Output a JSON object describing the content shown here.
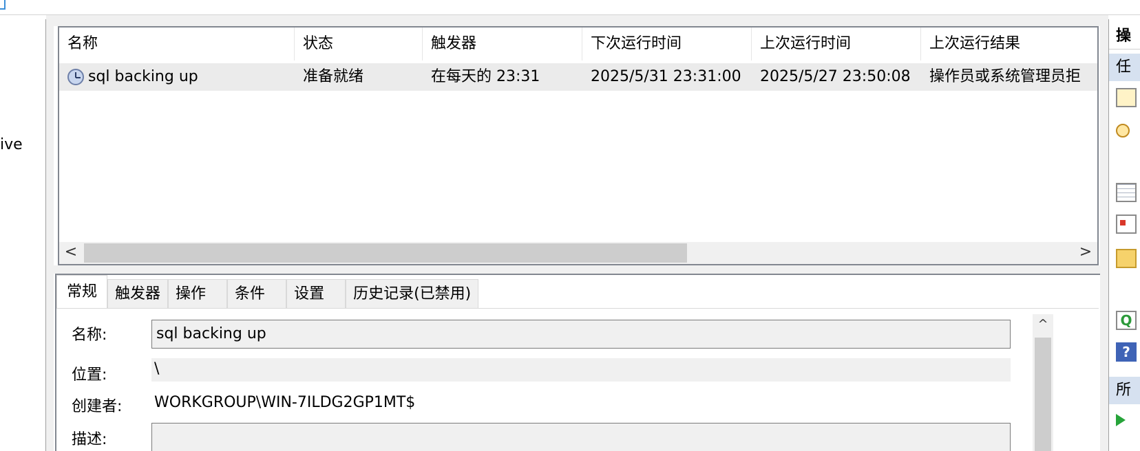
{
  "left_pane": {
    "partial_text": "ive"
  },
  "task_list": {
    "columns": [
      "名称",
      "状态",
      "触发器",
      "下次运行时间",
      "上次运行时间",
      "上次运行结果"
    ],
    "rows": [
      {
        "icon": "scheduled-task-icon",
        "name": "sql backing up",
        "status": "准备就绪",
        "trigger": "在每天的 23:31",
        "next_run": "2025/5/31 23:31:00",
        "last_run": "2025/5/27 23:50:08",
        "last_result": "操作员或系统管理员拒"
      }
    ],
    "scroll_left": "<",
    "scroll_right": ">"
  },
  "detail": {
    "tabs": [
      "常规",
      "触发器",
      "操作",
      "条件",
      "设置",
      "历史记录(已禁用)"
    ],
    "active_tab": "常规",
    "general": {
      "name_label": "名称:",
      "name_value": "sql backing up",
      "location_label": "位置:",
      "location_value": "\\",
      "author_label": "创建者:",
      "author_value": "WORKGROUP\\WIN-7ILDG2GP1MT$",
      "description_label": "描述:",
      "description_value": ""
    },
    "scroll_up": "^"
  },
  "actions_pane": {
    "header": "操",
    "section_task": "任",
    "section_selected": "所",
    "help_glyph": "?",
    "refresh_glyph": "Q"
  },
  "colors": {
    "selected_row": "#ebebeb",
    "section_band": "#d6e1f0",
    "border": "#828790"
  }
}
